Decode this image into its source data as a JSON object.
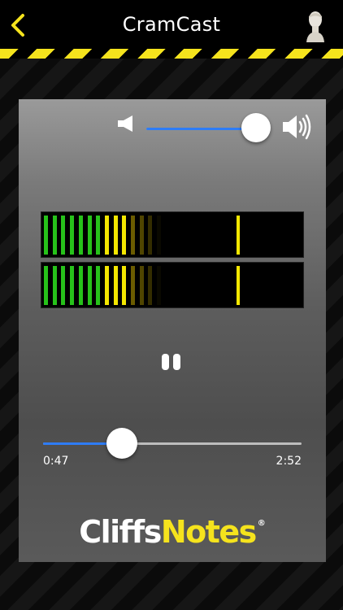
{
  "header": {
    "title": "CramCast",
    "back_icon": "chevron-left-icon",
    "avatar_icon": "bust-avatar-icon"
  },
  "colors": {
    "accent_yellow": "#f5e31d",
    "slider_blue": "#2e7cf6",
    "meter_green": "#27c21a",
    "meter_yellow": "#f4e700"
  },
  "player": {
    "volume": {
      "level": 0.86,
      "low_icon": "volume-low-icon",
      "high_icon": "volume-high-icon"
    },
    "meters": {
      "left_level": 0.31,
      "right_level": 0.31,
      "peak_position": 0.75
    },
    "playback": {
      "state": "playing",
      "pause_icon": "pause-icon"
    },
    "progress": {
      "elapsed": "0:47",
      "total": "2:52",
      "fraction": 0.27
    }
  },
  "logo": {
    "part1": "Cliffs",
    "part2": "Notes",
    "registered": "®"
  }
}
